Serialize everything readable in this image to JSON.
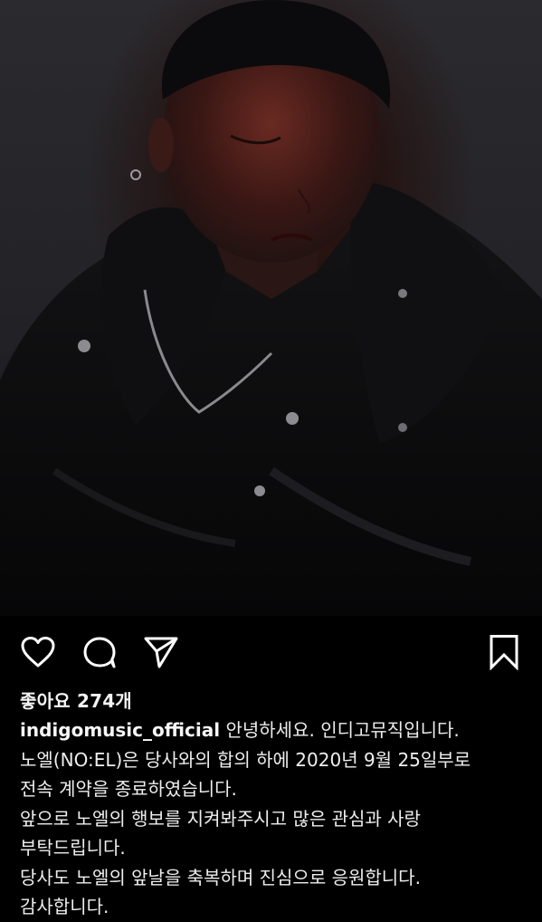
{
  "post": {
    "image": {
      "subject": "portrait photo",
      "accent_color": "#8a2a22"
    },
    "actions": {
      "like_icon": "heart-outline-icon",
      "comment_icon": "comment-bubble-icon",
      "share_icon": "paper-plane-icon",
      "save_icon": "bookmark-outline-icon"
    },
    "likes_text": "좋아요 274개",
    "caption": {
      "username": "indigomusic_official",
      "first_line_text": " 안녕하세요. 인디고뮤직입니다.",
      "lines": [
        "노엘(NO:EL)은 당사와의 합의 하에 2020년 9월 25일부로",
        "전속 계약을 종료하였습니다.",
        "앞으로 노엘의 행보를 지켜봐주시고 많은 관심과 사랑",
        "부탁드립니다.",
        "당사도 노엘의 앞날을 축복하며 진심으로 응원합니다.",
        "감사합니다."
      ]
    }
  },
  "theme": {
    "background": "#000000",
    "text": "#eeeeee"
  }
}
